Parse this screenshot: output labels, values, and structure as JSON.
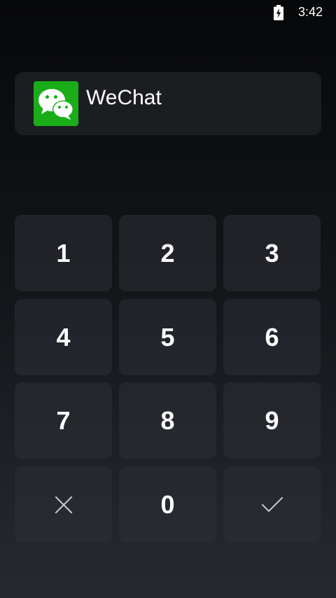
{
  "status_bar": {
    "battery_icon": "battery-charging-icon",
    "time": "3:42"
  },
  "app": {
    "icon": "wechat-icon",
    "icon_color": "#1aad19",
    "name": "WeChat"
  },
  "keypad": {
    "keys": [
      "1",
      "2",
      "3",
      "4",
      "5",
      "6",
      "7",
      "8",
      "9"
    ],
    "zero": "0",
    "cancel_icon": "close-icon",
    "confirm_icon": "check-icon"
  }
}
